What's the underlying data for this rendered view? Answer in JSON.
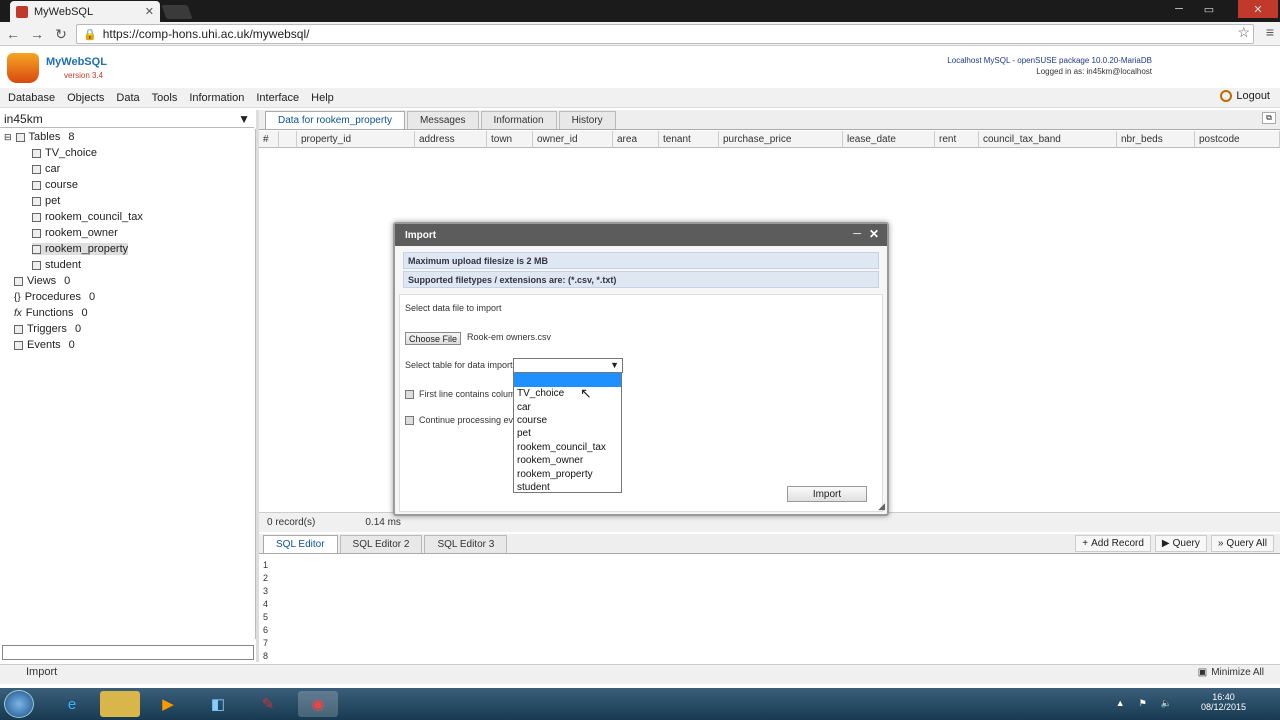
{
  "browser": {
    "tab_title": "MyWebSQL",
    "url": "https://comp-hons.uhi.ac.uk/mywebsql/"
  },
  "app": {
    "name": "MyWebSQL",
    "version": "version 3.4",
    "server_info": "Localhost MySQL - openSUSE package 10.0.20-MariaDB",
    "logged_in": "Logged in as: in45km@localhost",
    "logout": "Logout",
    "menu": [
      "Database",
      "Objects",
      "Data",
      "Tools",
      "Information",
      "Interface",
      "Help"
    ]
  },
  "sidebar": {
    "database": "in45km",
    "tables_label": "Tables",
    "tables_count": "8",
    "tables": [
      "TV_choice",
      "car",
      "course",
      "pet",
      "rookem_council_tax",
      "rookem_owner",
      "rookem_property",
      "student"
    ],
    "groups": [
      {
        "label": "Views",
        "count": "0"
      },
      {
        "label": "Procedures",
        "count": "0"
      },
      {
        "label": "Functions",
        "count": "0"
      },
      {
        "label": "Triggers",
        "count": "0"
      },
      {
        "label": "Events",
        "count": "0"
      }
    ]
  },
  "main": {
    "tabs": [
      "Data for rookem_property",
      "Messages",
      "Information",
      "History"
    ],
    "columns": [
      "#",
      "",
      "property_id",
      "address",
      "town",
      "owner_id",
      "area",
      "tenant",
      "purchase_price",
      "lease_date",
      "rent",
      "council_tax_band",
      "nbr_beds",
      "postcode"
    ],
    "records": "0 record(s)",
    "time": "0.14 ms"
  },
  "editor": {
    "tabs": [
      "SQL Editor",
      "SQL Editor 2",
      "SQL Editor 3"
    ],
    "buttons": [
      "Add Record",
      "Query",
      "Query All"
    ],
    "line_numbers": [
      "1",
      "2",
      "3",
      "4",
      "5",
      "6",
      "7",
      "8"
    ]
  },
  "bottom": {
    "import": "Import",
    "minimize_all": "Minimize All"
  },
  "dialog": {
    "title": "Import",
    "max_upload": "Maximum upload filesize is 2 MB",
    "filetypes": "Supported filetypes / extensions are: (*.csv, *.txt)",
    "select_file": "Select data file to import",
    "choose_file": "Choose File",
    "file_name": "Rook-em owners.csv",
    "select_table": "Select table for data import",
    "first_line": "First line contains column",
    "continue": "Continue processing eve",
    "import_button": "Import",
    "dropdown_options": [
      "",
      "TV_choice",
      "car",
      "course",
      "pet",
      "rookem_council_tax",
      "rookem_owner",
      "rookem_property",
      "student"
    ]
  },
  "taskbar": {
    "time": "16:40",
    "date": "08/12/2015"
  }
}
